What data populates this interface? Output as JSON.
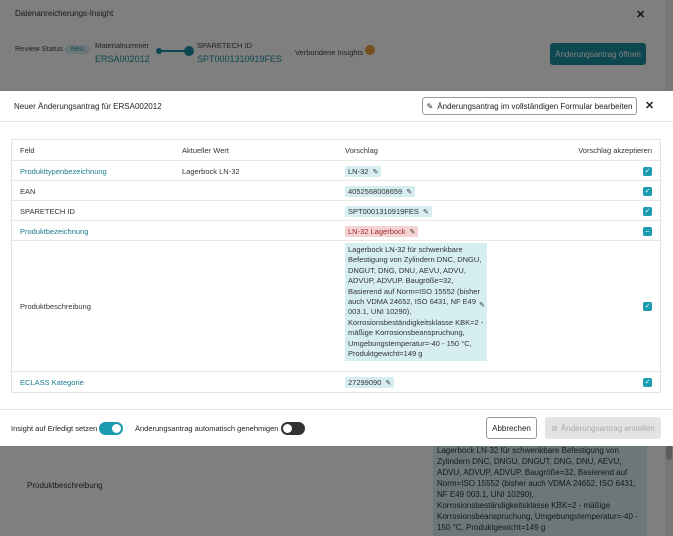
{
  "background": {
    "title": "Datenanreicherungs-Insight",
    "review_status_label": "Review Status",
    "review_status_value": "Neu",
    "material_label": "Materialnummer",
    "material_value": "ERSA002012",
    "sparetech_label": "SPARETECH ID",
    "sparetech_value": "SPT0001310919FES",
    "connected_label": "Verbundene Insights",
    "open_request_button": "Änderungsantrag öffnen",
    "lower_field": "Produktbeschreibung",
    "lower_text": "Lagerbock LN-32 für schwenkbare Befestigung von Zylindern DNC, DNGU, DNGUT, DNG, DNU, AEVU, ADVU, ADVUP, ADVUP. Baugröße=32, Basierend auf Norm=ISO 15552 (bisher auch VDMA 24652, ISO 6431, NF E49 003.1, UNI 10290), Korrosionsbeständigkeitsklasse KBK=2 - mäßige Korrosionsbeanspruchung, Umgebungstemperatur=-40 - 150 °C, Produktgewicht=149 g"
  },
  "modal": {
    "title": "Neuer Änderungsantrag für ERSA002012",
    "edit_button": "Änderungsantrag im vollständigen Formular bearbeiten",
    "columns": {
      "field": "Feld",
      "current": "Aktueller Wert",
      "suggestion": "Vorschlag",
      "accept": "Vorschlag akzeptieren"
    },
    "rows": [
      {
        "field": "Produkttypenbezeichnung",
        "current": "Lagerbock LN-32",
        "suggestion": "LN-32"
      },
      {
        "field": "EAN",
        "current": "",
        "suggestion": "4052568008659"
      },
      {
        "field": "SPARETECH ID",
        "current": "",
        "suggestion": "SPT0001310919FES"
      },
      {
        "field": "Produktbezeichnung",
        "current": "",
        "suggestion": "LN-32 Lagerbock"
      },
      {
        "field": "Produktbeschreibung",
        "current": "",
        "suggestion": "Lagerbock LN-32 für schwenkbare Befestigung von Zylindern DNC, DNGU, DNGUT, DNG, DNU, AEVU, ADVU, ADVUP, ADVUP. Baugröße=32, Basierend auf Norm=ISO 15552 (bisher auch VDMA 24652, ISO 6431, NF E49 003.1, UNI 10290), Korrosionsbeständigkeitsklasse KBK=2 - mäßige Korrosionsbeanspruchung, Umgebungstemperatur=-40 - 150 °C, Produktgewicht=149 g"
      },
      {
        "field": "ECLASS Kategorie",
        "current": "",
        "suggestion": "27299090"
      }
    ],
    "footer": {
      "insight_done_label": "Insight auf Erledigt setzen",
      "auto_approve_label": "Änderungsantrag automatisch genehmigen",
      "cancel_button": "Abbrechen",
      "create_button": "Änderungsantrag erstellen"
    }
  },
  "colors": {
    "accent": "#1a9bb0",
    "suggestion_bg": "#d6eef2",
    "conflict_bg": "#f6d3d3"
  }
}
